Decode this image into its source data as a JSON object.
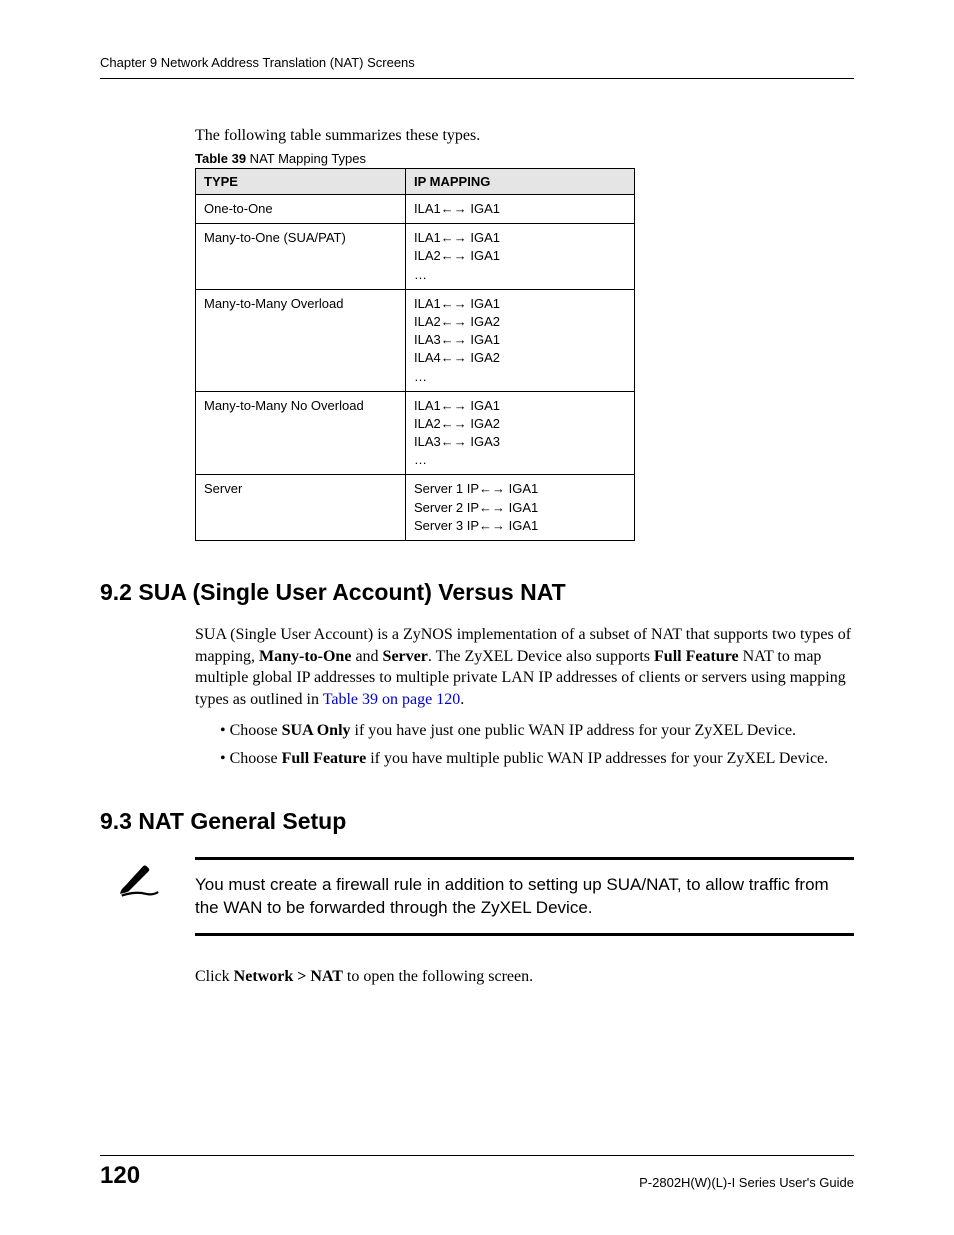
{
  "header": "Chapter 9 Network Address Translation (NAT) Screens",
  "intro": "The following table summarizes these types.",
  "table": {
    "caption_bold": "Table 39",
    "caption_rest": "   NAT Mapping Types",
    "headers": {
      "type": "TYPE",
      "mapping": "IP MAPPING"
    },
    "rows": [
      {
        "type": "One-to-One",
        "mapping": "ILA1←→ IGA1"
      },
      {
        "type": "Many-to-One (SUA/PAT)",
        "mapping": "ILA1←→ IGA1\nILA2←→ IGA1\n…"
      },
      {
        "type": "Many-to-Many Overload",
        "mapping": "ILA1←→ IGA1\nILA2←→ IGA2\nILA3←→ IGA1\nILA4←→ IGA2\n…"
      },
      {
        "type": "Many-to-Many No Overload",
        "mapping": "ILA1←→ IGA1\nILA2←→ IGA2\nILA3←→ IGA3\n…"
      },
      {
        "type": "Server",
        "mapping": "Server 1 IP←→ IGA1\nServer 2 IP←→ IGA1\nServer 3 IP←→ IGA1"
      }
    ]
  },
  "section92": {
    "heading": "9.2  SUA (Single User Account) Versus NAT",
    "para_parts": {
      "p1": "SUA (Single User Account) is a ZyNOS implementation of a subset of NAT that supports two types of mapping, ",
      "b1": "Many-to-One",
      "p2": " and ",
      "b2": "Server",
      "p3": ". The ZyXEL Device also supports ",
      "b3": "Full Feature",
      "p4": " NAT to map multiple global IP addresses to multiple private LAN IP addresses of clients or servers using mapping types as outlined in ",
      "link": "Table 39 on page 120",
      "p5": "."
    },
    "bullets": [
      {
        "pre": "Choose ",
        "bold": "SUA Only",
        "post": " if you have just one public WAN IP address for your ZyXEL Device."
      },
      {
        "pre": "Choose ",
        "bold": "Full Feature",
        "post": " if you have multiple public WAN IP addresses for your ZyXEL Device."
      }
    ]
  },
  "section93": {
    "heading": "9.3  NAT General Setup",
    "note": "You must create a firewall rule in addition to setting up SUA/NAT, to allow traffic from the WAN to be forwarded through the ZyXEL Device.",
    "click_pre": "Click ",
    "click_bold": "Network > NAT",
    "click_post": " to open the following screen."
  },
  "footer": {
    "page": "120",
    "guide": "P-2802H(W)(L)-I Series User's Guide"
  }
}
